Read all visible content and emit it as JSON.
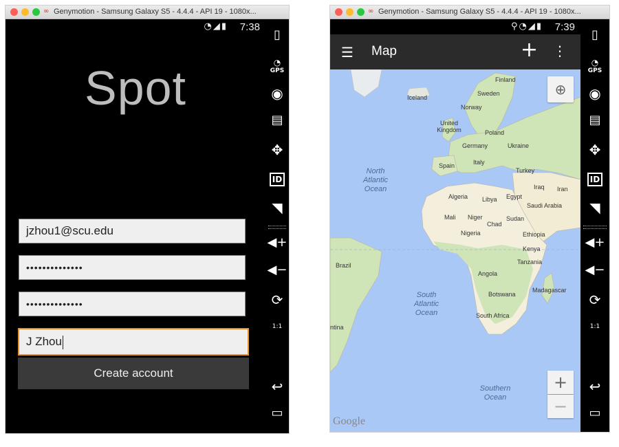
{
  "left_window": {
    "title": "Genymotion - Samsung Galaxy S5 - 4.4.4 - API 19 - 1080x...",
    "status": {
      "time": "7:38"
    },
    "app_title": "Spot",
    "form": {
      "email": "jzhou1@scu.edu",
      "password": "••••••••••••••",
      "password_confirm": "••••••••••••••",
      "name": "J Zhou"
    },
    "create_button": "Create account"
  },
  "right_window": {
    "title": "Genymotion - Samsung Galaxy S5 - 4.4.4 - API 19 - 1080x...",
    "status": {
      "time": "7:39"
    },
    "toolbar": {
      "title": "Map"
    },
    "map": {
      "countries": [
        "Finland",
        "Sweden",
        "Norway",
        "Iceland",
        "United Kingdom",
        "Poland",
        "Germany",
        "Ukraine",
        "Spain",
        "Italy",
        "Turkey",
        "Iraq",
        "Iran",
        "Algeria",
        "Libya",
        "Egypt",
        "Saudi Arabia",
        "Mali",
        "Niger",
        "Chad",
        "Sudan",
        "Nigeria",
        "Ethiopia",
        "Kenya",
        "Tanzania",
        "Brazil",
        "Angola",
        "Botswana",
        "Madagascar",
        "South Africa",
        "ntina"
      ],
      "oceans": [
        "North Atlantic Ocean",
        "South Atlantic Ocean",
        "Southern Ocean"
      ],
      "attribution": "Google"
    }
  },
  "sidebar": {
    "gps_label": "GPS",
    "id_label": "ID",
    "pixel_label": "1:1"
  },
  "icons": {
    "wifi": "wifi-icon",
    "signal": "signal-icon",
    "battery": "battery-icon",
    "location": "location-icon",
    "menu": "hamburger-menu-icon",
    "add": "plus-icon",
    "overflow": "overflow-menu-icon",
    "my_location": "my-location-icon",
    "zoom_in": "zoom-in-icon",
    "zoom_out": "zoom-out-icon"
  },
  "colors": {
    "focus_border": "#e8902c",
    "ocean": "#a9c8f6",
    "land": "#f3efdc",
    "green_land": "#cfe4b7",
    "toolbar": "#2b2b2b"
  }
}
